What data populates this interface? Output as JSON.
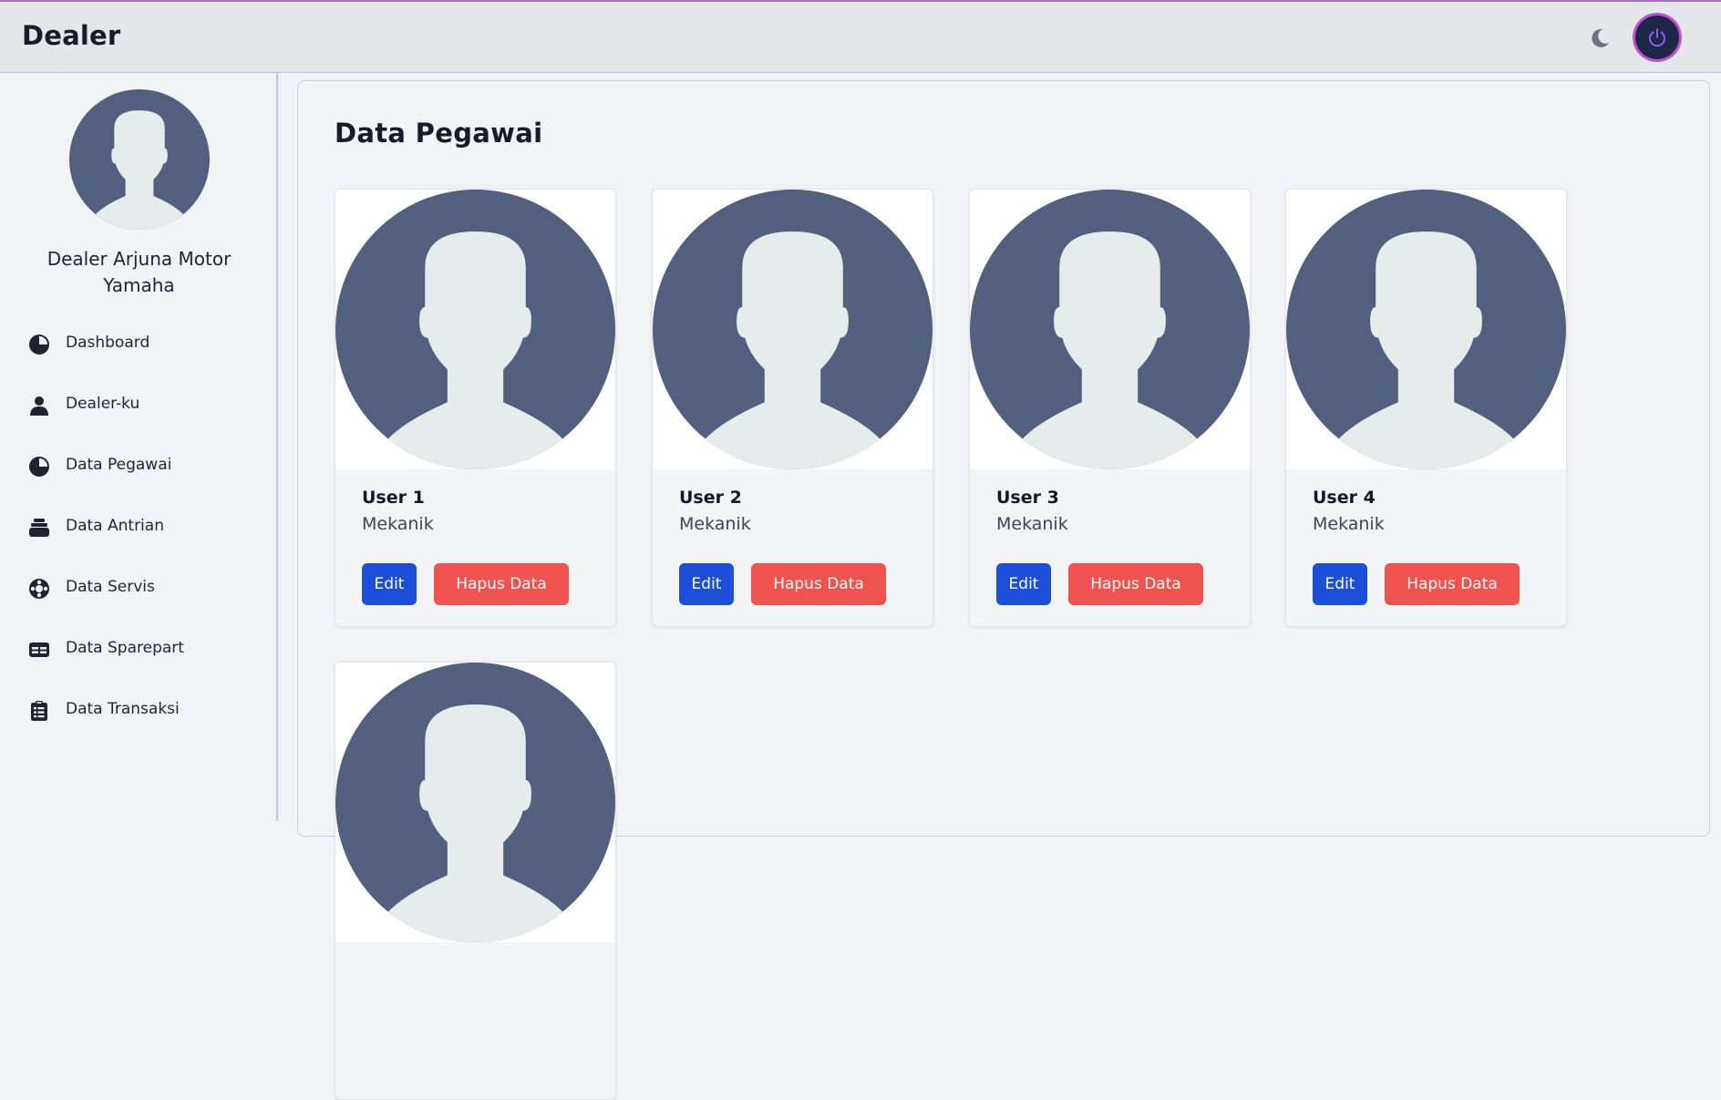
{
  "app": {
    "title": "Dealer"
  },
  "header": {
    "theme_toggle_icon": "moon-icon",
    "power_icon": "power-icon",
    "power_ring_color": "#c24fd2"
  },
  "sidebar": {
    "avatar_icon": "user-avatar-icon",
    "dealer_name": "Dealer Arjuna Motor Yamaha",
    "items": [
      {
        "label": "Dashboard",
        "icon": "pie-chart-icon"
      },
      {
        "label": "Dealer-ku",
        "icon": "user-icon"
      },
      {
        "label": "Data Pegawai",
        "icon": "pie-chart-icon"
      },
      {
        "label": "Data Antrian",
        "icon": "stack-icon"
      },
      {
        "label": "Data Servis",
        "icon": "lifebuoy-icon"
      },
      {
        "label": "Data Sparepart",
        "icon": "id-card-icon"
      },
      {
        "label": "Data Transaksi",
        "icon": "clipboard-list-icon"
      }
    ]
  },
  "main": {
    "title": "Data Pegawai",
    "employees": [
      {
        "name": "User 1",
        "role": "Mekanik",
        "edit_label": "Edit",
        "delete_label": "Hapus Data"
      },
      {
        "name": "User 2",
        "role": "Mekanik",
        "edit_label": "Edit",
        "delete_label": "Hapus Data"
      },
      {
        "name": "User 3",
        "role": "Mekanik",
        "edit_label": "Edit",
        "delete_label": "Hapus Data"
      },
      {
        "name": "User 4",
        "role": "Mekanik",
        "edit_label": "Edit",
        "delete_label": "Hapus Data"
      },
      {
        "name": "",
        "role": "",
        "edit_label": "",
        "delete_label": ""
      }
    ]
  },
  "colors": {
    "edit_button": "#1d4ed8",
    "delete_button": "#ef5350",
    "avatar_bg": "#535f7f",
    "avatar_fg": "#e6ebec"
  }
}
